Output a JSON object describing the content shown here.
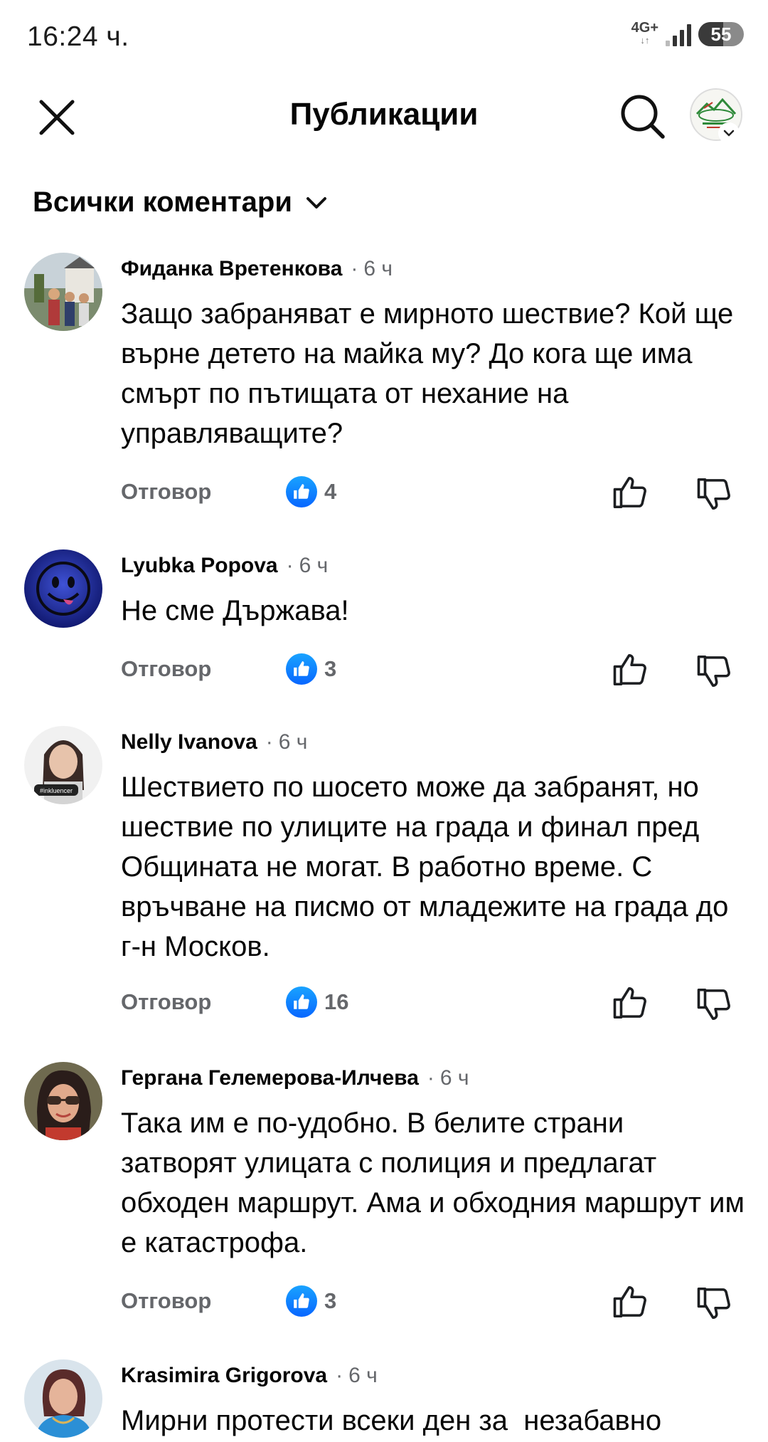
{
  "status_bar": {
    "time": "16:24 ч.",
    "network": "4G+",
    "battery": "55"
  },
  "header": {
    "title": "Публикации",
    "close_icon": "close-icon",
    "search_icon": "search-icon"
  },
  "filter": {
    "label": "Всички коментари"
  },
  "comments": [
    {
      "name": "Фиданка Вретенкова",
      "time": "6 ч",
      "text": "Защо забраняват е мирното шествие? Кой ще върне детето на майка му? До кога ще има смърт по пътищата от нехание на управляващите?",
      "reply": "Отговор",
      "likes": "4"
    },
    {
      "name": "Lyubka Popova",
      "time": "6 ч",
      "text": "Не сме Държава!",
      "reply": "Отговор",
      "likes": "3"
    },
    {
      "name": "Nelly Ivanova",
      "time": "6 ч",
      "text": "Шествието по шосето може да забранят, но шествие по улиците на града и финал пред Общината не могат. В работно време. С връчване на писмо от младежите на града до г-н Москов.",
      "reply": "Отговор",
      "likes": "16",
      "avatar_tag": "#inkluencer"
    },
    {
      "name": "Гергана Гелемерова-Илчева",
      "time": "6 ч",
      "text": "Така им е по-удобно. В белите страни затворят улицата с полиция и предлагат обходен маршрут. Ама и обходния маршрут им е катастрофа.",
      "reply": "Отговор",
      "likes": "3"
    },
    {
      "name": "Krasimira Grigorova",
      "time": "6 ч",
      "text": "Мирни протести всеки ден за  незабавно"
    }
  ],
  "colors": {
    "like_blue": "#0866ff",
    "secondary_text": "#65676b"
  }
}
